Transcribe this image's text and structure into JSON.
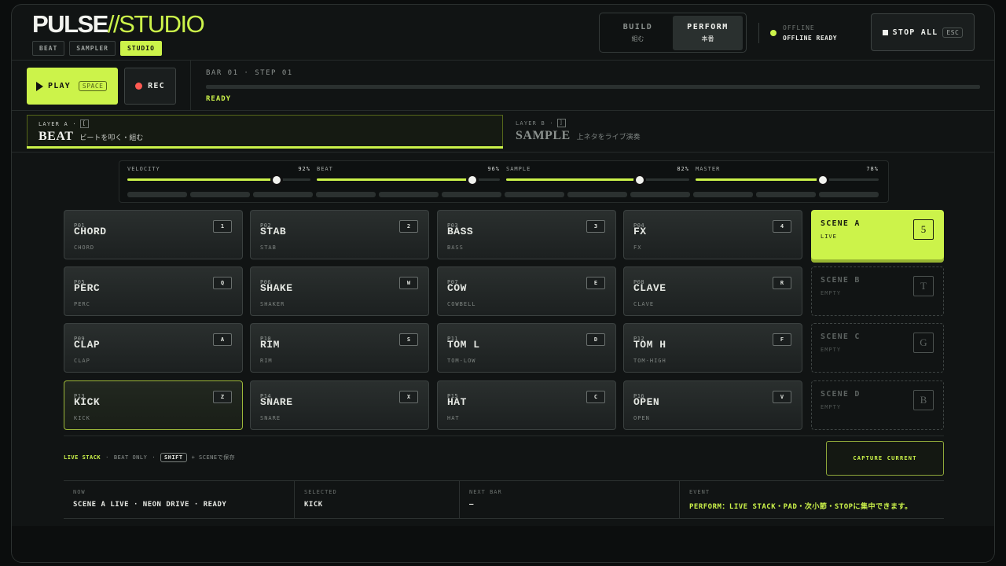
{
  "app": {
    "logo_bold": "PULSE",
    "logo_light": "//STUDIO"
  },
  "mode_tabs": [
    {
      "label": "BEAT"
    },
    {
      "label": "SAMPLER"
    },
    {
      "label": "STUDIO",
      "active": true
    }
  ],
  "view_switch": {
    "build": {
      "label": "BUILD",
      "sub": "組む"
    },
    "perform": {
      "label": "PERFORM",
      "sub": "本番",
      "active": true
    }
  },
  "connection": {
    "status": "OFFLINE",
    "detail": "OFFLINE READY"
  },
  "stop_all": {
    "label": "STOP ALL",
    "key": "ESC"
  },
  "transport": {
    "play_label": "PLAY",
    "play_key": "SPACE",
    "rec_label": "REC",
    "position": "BAR 01 · STEP 01",
    "state": "READY",
    "progress": 0
  },
  "layers": {
    "a": {
      "tag": "LAYER A ·",
      "key": "[",
      "name": "BEAT",
      "desc": "ビートを叩く・組む"
    },
    "b": {
      "tag": "LAYER B ·",
      "key": "]",
      "name": "SAMPLE",
      "desc": "上ネタをライブ演奏"
    }
  },
  "sliders": [
    {
      "label": "VELOCITY",
      "value": "92%",
      "level": 0.92
    },
    {
      "label": "BEAT",
      "value": "96%",
      "level": 0.96
    },
    {
      "label": "SAMPLE",
      "value": "82%",
      "level": 0.82
    },
    {
      "label": "MASTER",
      "value": "78%",
      "level": 0.78
    }
  ],
  "pads": [
    {
      "id": "P01",
      "name": "CHORD",
      "sub": "CHORD",
      "key": "1"
    },
    {
      "id": "P02",
      "name": "STAB",
      "sub": "STAB",
      "key": "2"
    },
    {
      "id": "P03",
      "name": "BASS",
      "sub": "BASS",
      "key": "3"
    },
    {
      "id": "P04",
      "name": "FX",
      "sub": "FX",
      "key": "4"
    },
    {
      "id": "P05",
      "name": "PERC",
      "sub": "PERC",
      "key": "Q"
    },
    {
      "id": "P06",
      "name": "SHAKE",
      "sub": "SHAKER",
      "key": "W"
    },
    {
      "id": "P07",
      "name": "COW",
      "sub": "COWBELL",
      "key": "E"
    },
    {
      "id": "P08",
      "name": "CLAVE",
      "sub": "CLAVE",
      "key": "R"
    },
    {
      "id": "P09",
      "name": "CLAP",
      "sub": "CLAP",
      "key": "A"
    },
    {
      "id": "P10",
      "name": "RIM",
      "sub": "RIM",
      "key": "S"
    },
    {
      "id": "P11",
      "name": "TOM L",
      "sub": "TOM-LOW",
      "key": "D"
    },
    {
      "id": "P12",
      "name": "TOM H",
      "sub": "TOM-HIGH",
      "key": "F"
    },
    {
      "id": "P13",
      "name": "KICK",
      "sub": "KICK",
      "key": "Z",
      "selected": true
    },
    {
      "id": "P14",
      "name": "SNARE",
      "sub": "SNARE",
      "key": "X"
    },
    {
      "id": "P15",
      "name": "HAT",
      "sub": "HAT",
      "key": "C"
    },
    {
      "id": "P16",
      "name": "OPEN",
      "sub": "OPEN",
      "key": "V"
    }
  ],
  "scenes": [
    {
      "name": "SCENE A",
      "state": "LIVE",
      "key": "5",
      "active": true
    },
    {
      "name": "SCENE B",
      "state": "EMPTY",
      "key": "T"
    },
    {
      "name": "SCENE C",
      "state": "EMPTY",
      "key": "G"
    },
    {
      "name": "SCENE D",
      "state": "EMPTY",
      "key": "B"
    }
  ],
  "footer": {
    "live_stack": "LIVE STACK",
    "sep1": "·",
    "beat_only": "BEAT ONLY",
    "sep2": "·",
    "shift_key": "SHIFT",
    "save_hint": "+ SCENEで保存",
    "capture_label": "CAPTURE CURRENT"
  },
  "status": {
    "now_label": "NOW",
    "now_value": "SCENE A LIVE · NEON DRIVE · READY",
    "selected_label": "SELECTED",
    "selected_value": "KICK",
    "next_label": "NEXT BAR",
    "next_value": "—",
    "event_label": "EVENT",
    "event_value": "PERFORM：LIVE STACK・PAD・次小節・STOPに集中できます。"
  },
  "colors": {
    "accent": "#ccf34a",
    "rec": "#ff5a52",
    "background": "#111414"
  }
}
